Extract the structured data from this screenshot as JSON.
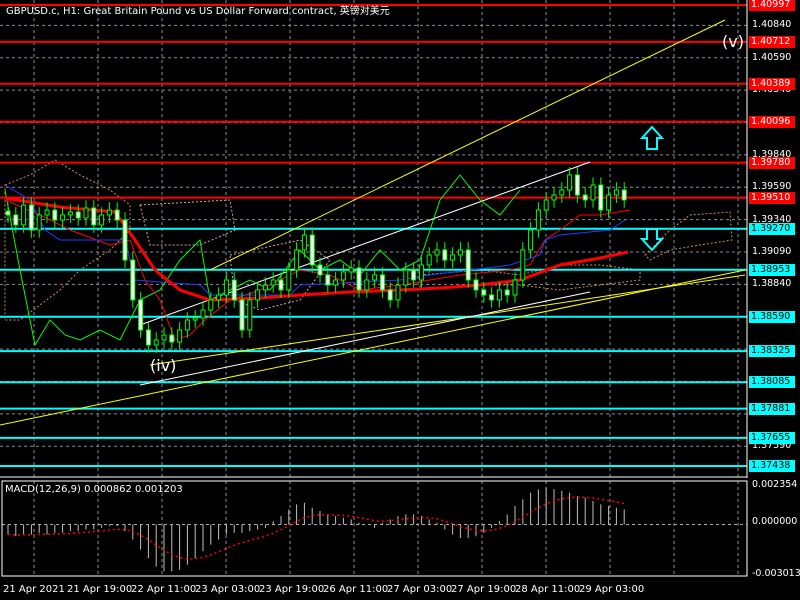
{
  "window": {
    "title": "GBPUSD.c, H1:  Great Britain Pound vs US Dollar Forward contract, 英镑对美元"
  },
  "colors": {
    "background": "#000000",
    "resistance": "#ff0000",
    "support": "#00ffff",
    "bull": "#00ff00",
    "trend": "#ffff00",
    "channel": "#ffffff",
    "ma": "#ff0000",
    "kijun": "#0000ff",
    "cloud": "#f4a460"
  },
  "annotations": {
    "wave_v": "(v)",
    "wave_iv": "(iv)",
    "arrow_up": "up-arrow-icon",
    "arrow_down": "down-arrow-icon"
  },
  "price_axis": {
    "ticks": [
      "1.40840",
      "1.40590",
      "1.40340",
      "1.39840",
      "1.39590",
      "1.39340",
      "1.39090",
      "1.38840",
      "1.37590"
    ],
    "resistance_levels": [
      "1.40997",
      "1.40712",
      "1.40389",
      "1.40096",
      "1.39780",
      "1.39510"
    ],
    "support_levels": [
      "1.39270",
      "1.38953",
      "1.38590",
      "1.38325",
      "1.38085",
      "1.37881",
      "1.37655",
      "1.37438"
    ]
  },
  "time_axis": [
    "21 Apr 2021",
    "21 Apr 19:00",
    "22 Apr 11:00",
    "23 Apr 03:00",
    "23 Apr 19:00",
    "26 Apr 11:00",
    "27 Apr 03:00",
    "27 Apr 19:00",
    "28 Apr 11:00",
    "29 Apr 03:00"
  ],
  "macd": {
    "title": "MACD(12,26,9) 0.000862 0.001203",
    "axis_max": "0.002354",
    "axis_zero": "0.000000",
    "axis_min": "-0.003013"
  },
  "chart_data": {
    "type": "candlestick",
    "symbol": "GBPUSD.c",
    "timeframe": "H1",
    "ylim": [
      1.3735,
      1.4102
    ],
    "closes": [
      1.39376,
      1.39299,
      1.39453,
      1.3926,
      1.39376,
      1.39414,
      1.39337,
      1.39376,
      1.39399,
      1.39353,
      1.3943,
      1.39299,
      1.39376,
      1.39414,
      1.39337,
      1.39028,
      1.3872,
      1.38488,
      1.38372,
      1.38411,
      1.38449,
      1.38395,
      1.38488,
      1.38565,
      1.38581,
      1.38642,
      1.3872,
      1.38758,
      1.38874,
      1.3872,
      1.38488,
      1.3872,
      1.38797,
      1.38835,
      1.38874,
      1.38797,
      1.38951,
      1.39106,
      1.39221,
      1.3899,
      1.38913,
      1.38835,
      1.38874,
      1.38936,
      1.38967,
      1.38797,
      1.38874,
      1.38913,
      1.38797,
      1.3872,
      1.38835,
      1.38951,
      1.38874,
      1.3899,
      1.39067,
      1.39106,
      1.39028,
      1.39067,
      1.39106,
      1.38874,
      1.38797,
      1.38758,
      1.3872,
      1.38797,
      1.38758,
      1.38874,
      1.39106,
      1.3926,
      1.39414,
      1.39492,
      1.3953,
      1.39569,
      1.39685,
      1.3953,
      1.39492,
      1.39607,
      1.39414,
      1.3953,
      1.39569,
      1.39492
    ],
    "macd_values": [
      -0.0006,
      -0.0007,
      -0.0006,
      -0.0006,
      -0.0005,
      -0.0006,
      -0.0005,
      -0.0005,
      -0.0004,
      -0.0004,
      -0.0003,
      -0.0003,
      -0.0002,
      -0.0001,
      -0.0001,
      -0.0004,
      -0.0009,
      -0.0015,
      -0.002,
      -0.0025,
      -0.0028,
      -0.0028,
      -0.0027,
      -0.0024,
      -0.002,
      -0.0016,
      -0.0012,
      -0.0009,
      -0.0006,
      -0.0005,
      -0.0005,
      -0.0004,
      -0.0003,
      -0.0002,
      0.0002,
      0.0005,
      0.0009,
      0.0012,
      0.0013,
      0.001,
      0.0008,
      0.0006,
      0.0005,
      0.0004,
      0.0003,
      0.0001,
      0.0,
      -0.0002,
      0.0001,
      0.0003,
      0.0005,
      0.0006,
      0.0006,
      0.0005,
      0.0003,
      0.0001,
      -0.0003,
      -0.0006,
      -0.0008,
      -0.0008,
      -0.0007,
      -0.0005,
      -0.0002,
      0.0002,
      0.0006,
      0.0011,
      0.0015,
      0.0019,
      0.0021,
      0.0022,
      0.0021,
      0.002,
      0.0019,
      0.0017,
      0.0016,
      0.0014,
      0.0012,
      0.0011,
      0.001,
      0.0009
    ],
    "macd_ylim": [
      -0.003013,
      0.002354
    ]
  }
}
